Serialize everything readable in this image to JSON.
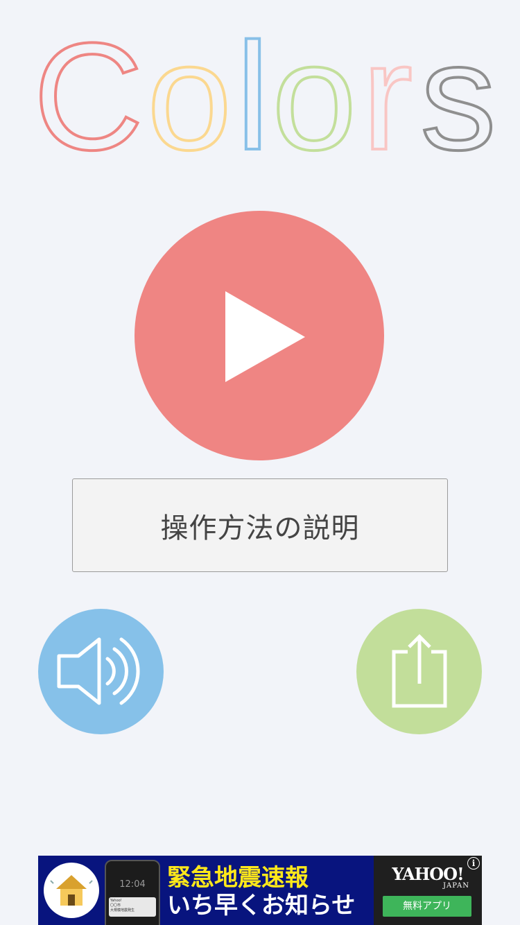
{
  "app": {
    "logo_letters": [
      {
        "char": "C",
        "color": "#ee8683"
      },
      {
        "char": "o",
        "color": "#fbd890"
      },
      {
        "char": "l",
        "color": "#88c0e8"
      },
      {
        "char": "o",
        "color": "#c3df9b"
      },
      {
        "char": "r",
        "color": "#f9c6c4"
      },
      {
        "char": "s",
        "color": "#8f8f8f"
      }
    ]
  },
  "colors": {
    "background": "#f2f4f9",
    "play": "#ef8583",
    "sound": "#86c1e9",
    "share": "#c2de9a"
  },
  "main": {
    "play_icon": "play-icon",
    "howto_label": "操作方法の説明",
    "sound_icon": "speaker-icon",
    "share_icon": "share-icon"
  },
  "ad": {
    "headline": "緊急地震速報",
    "subline": "いち早くお知らせ",
    "phone_time": "12:04",
    "phone_notice": "Yahoo!\n〇〇市\n大規模地震発生",
    "brand": "YAHOO!",
    "brand_sub": "JAPAN",
    "cta_label": "無料アプリ",
    "info_label": "i"
  }
}
